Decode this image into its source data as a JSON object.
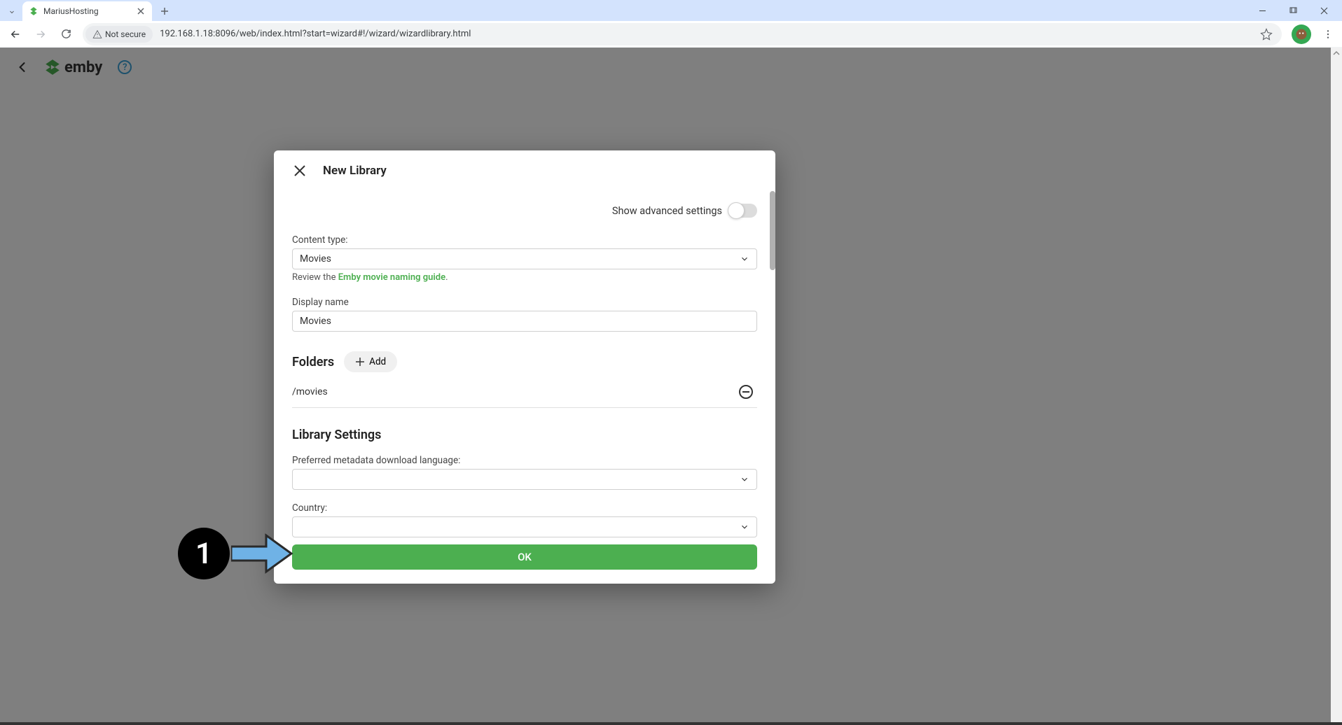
{
  "browser": {
    "tab_title": "MariusHosting",
    "security_label": "Not secure",
    "url": "192.168.1.18:8096/web/index.html?start=wizard#!/wizard/wizardlibrary.html"
  },
  "header": {
    "brand": "emby"
  },
  "dialog": {
    "title": "New Library",
    "advanced_label": "Show advanced settings",
    "content_type_label": "Content type:",
    "content_type_value": "Movies",
    "review_prefix": "Review the ",
    "review_link": "Emby movie naming guide",
    "display_name_label": "Display name",
    "display_name_value": "Movies",
    "folders_title": "Folders",
    "add_label": "Add",
    "folder_path": "/movies",
    "settings_title": "Library Settings",
    "metadata_lang_label": "Preferred metadata download language:",
    "metadata_lang_value": "",
    "country_label": "Country:",
    "country_value": "",
    "ok_label": "OK"
  },
  "annotation": {
    "step": "1"
  }
}
